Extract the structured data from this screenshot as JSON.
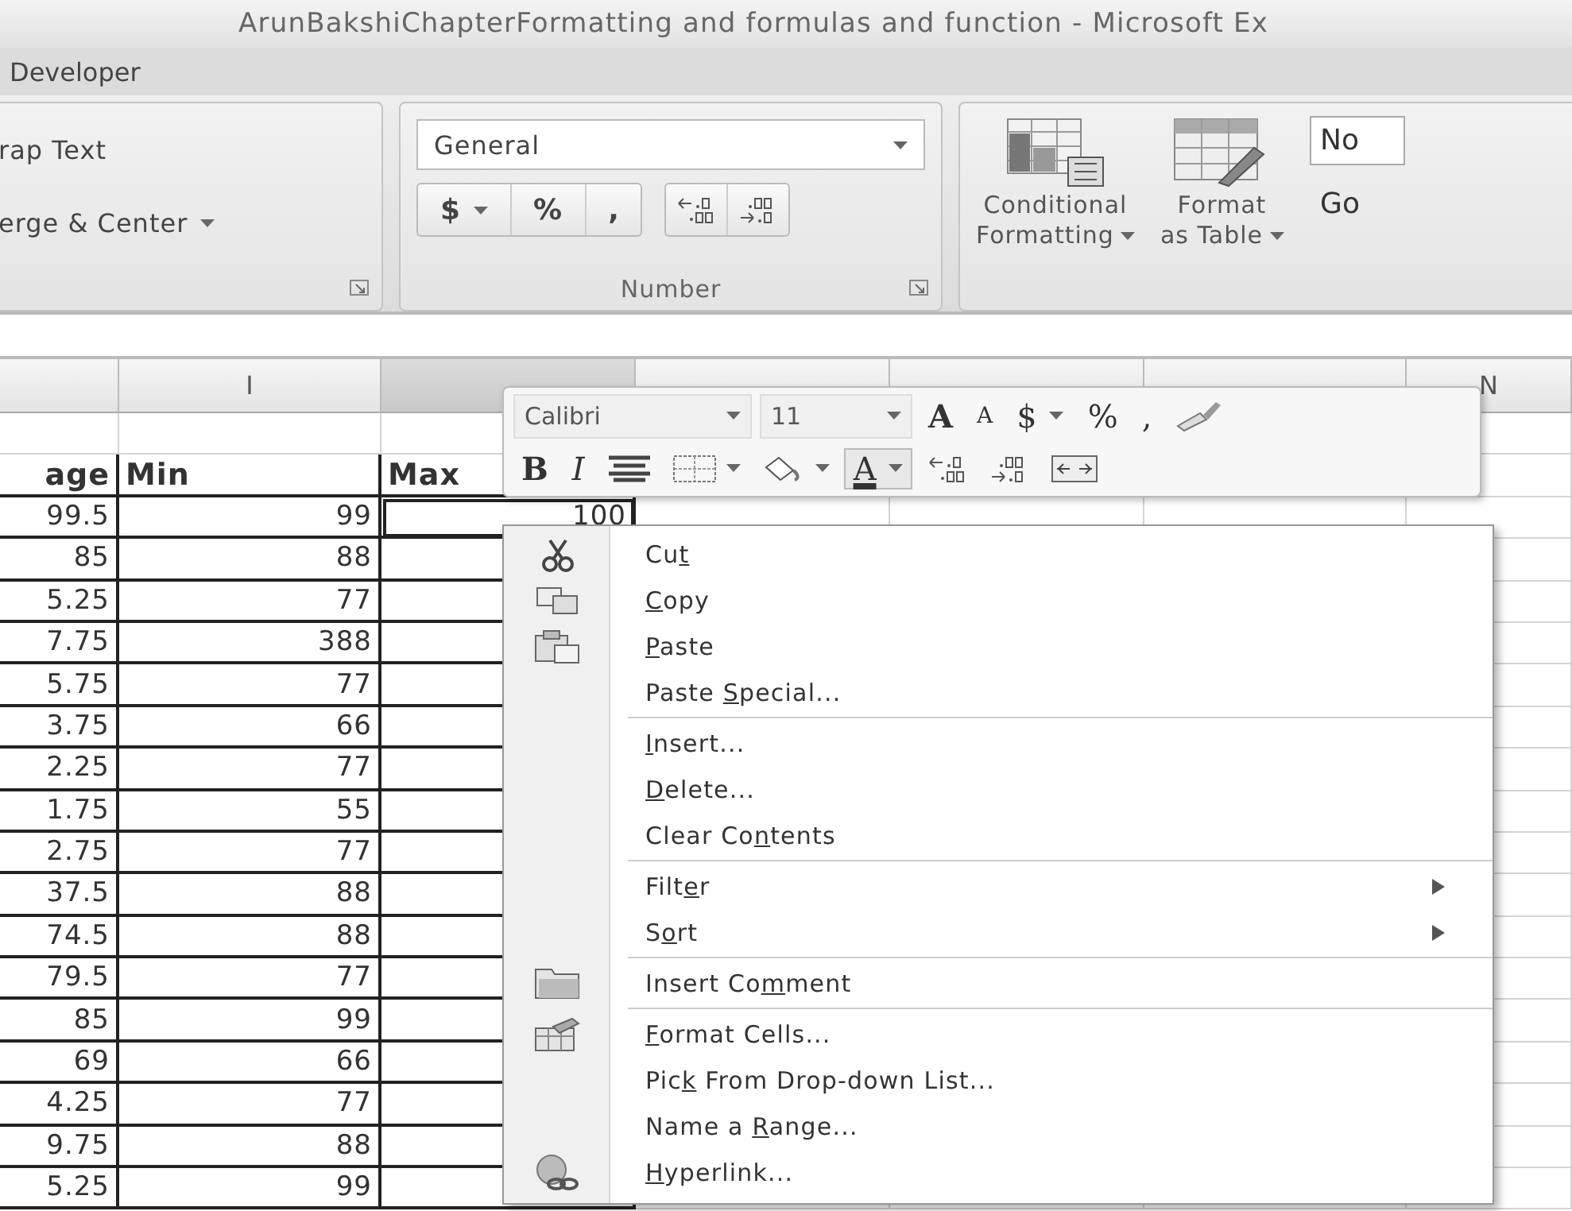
{
  "window": {
    "title": "ArunBakshiChapterFormatting and formulas and function - Microsoft Ex"
  },
  "ribbon_tab": {
    "label": "Developer"
  },
  "alignment_group": {
    "buttons": [
      "rap Text",
      "erge & Center"
    ]
  },
  "number_group": {
    "label": "Number",
    "format": "General",
    "buttons": [
      "$",
      "%",
      ","
    ]
  },
  "styles_group": {
    "buttons": [
      {
        "lines": [
          "Conditional",
          "Formatting"
        ]
      },
      {
        "lines": [
          "Format",
          "as Table"
        ]
      }
    ],
    "cell_styles": [
      "No",
      "Go"
    ]
  },
  "sheet": {
    "columns": [
      {
        "selected": false
      },
      {
        "letter": "I",
        "selected": false
      },
      {
        "selected": true
      },
      {
        "selected": false
      },
      {
        "selected": false
      },
      {
        "selected": false
      },
      {
        "letter": "N",
        "selected": false
      }
    ],
    "rows": [
      {
        "cells": [
          "age",
          "Min",
          "Max"
        ],
        "selected": false
      },
      {
        "cells": [
          "99.5",
          "99",
          "100"
        ],
        "selected": true
      },
      {
        "cells": [
          "85",
          "88"
        ],
        "selected": false
      },
      {
        "cells": [
          "5.25",
          "77"
        ],
        "selected": false
      },
      {
        "cells": [
          "7.75",
          "388"
        ],
        "selected": false
      },
      {
        "cells": [
          "5.75",
          "77"
        ],
        "selected": false
      },
      {
        "cells": [
          "3.75",
          "66"
        ],
        "selected": false
      },
      {
        "cells": [
          "2.25",
          "77"
        ],
        "selected": false
      },
      {
        "cells": [
          "1.75",
          "55"
        ],
        "selected": false
      },
      {
        "cells": [
          "2.75",
          "77"
        ],
        "selected": false
      },
      {
        "cells": [
          "37.5",
          "88"
        ],
        "selected": false
      },
      {
        "cells": [
          "74.5",
          "88"
        ],
        "selected": false
      },
      {
        "cells": [
          "79.5",
          "77"
        ],
        "selected": false
      },
      {
        "cells": [
          "85",
          "99"
        ],
        "selected": false
      },
      {
        "cells": [
          "69",
          "66"
        ],
        "selected": false
      },
      {
        "cells": [
          "4.25",
          "77"
        ],
        "selected": false
      },
      {
        "cells": [
          "9.75",
          "88"
        ],
        "selected": false
      },
      {
        "cells": [
          "5.25",
          "99"
        ],
        "selected": false
      }
    ]
  },
  "mini_toolbar": {
    "font_name": "Calibri",
    "font_size": "11",
    "buttons": [
      "A",
      "A",
      "$",
      "%",
      ",",
      "B",
      "I",
      "A"
    ]
  },
  "context_menu": {
    "groups": [
      [
        {
          "pre": "Cu",
          "key": "t",
          "submenu": false
        },
        {
          "key": "C",
          "post": "opy",
          "submenu": false
        },
        {
          "key": "P",
          "post": "aste",
          "submenu": false
        },
        {
          "pre": "Paste ",
          "key": "S",
          "post": "pecial...",
          "submenu": false
        }
      ],
      [
        {
          "key": "I",
          "post": "nsert...",
          "submenu": false
        },
        {
          "key": "D",
          "post": "elete...",
          "submenu": false
        },
        {
          "pre": "Clear Co",
          "key": "n",
          "post": "tents",
          "submenu": false
        }
      ],
      [
        {
          "pre": "Filt",
          "key": "e",
          "post": "r",
          "submenu": true
        },
        {
          "pre": "S",
          "key": "o",
          "post": "rt",
          "submenu": true
        }
      ],
      [
        {
          "pre": "Insert Co",
          "key": "m",
          "post": "ment",
          "submenu": false
        }
      ],
      [
        {
          "key": "F",
          "post": "ormat Cells...",
          "submenu": false
        },
        {
          "pre": "Pic",
          "key": "k",
          "post": " From Drop-down List...",
          "submenu": false
        },
        {
          "pre": "Name a ",
          "key": "R",
          "post": "ange...",
          "submenu": false
        },
        {
          "key": "H",
          "post": "yperlink...",
          "submenu": false
        }
      ]
    ]
  }
}
